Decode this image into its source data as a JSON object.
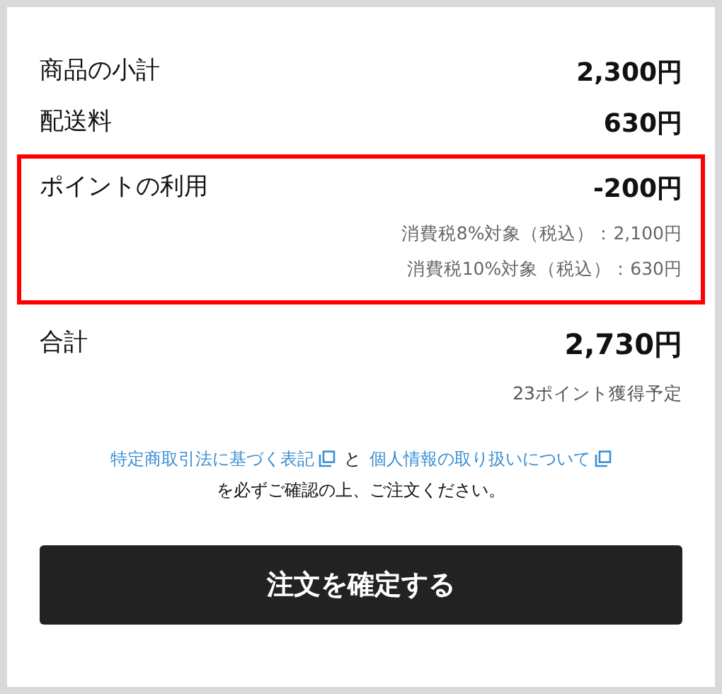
{
  "summary_rows": [
    {
      "label": "商品の小計",
      "value": "2,300円",
      "highlighted": false,
      "tax_lines": []
    },
    {
      "label": "配送料",
      "value": "630円",
      "highlighted": false,
      "tax_lines": []
    },
    {
      "label": "ポイントの利用",
      "value": "-200円",
      "highlighted": true,
      "tax_lines": [
        "消費税8%対象（税込）：2,100円",
        "消費税10%対象（税込）：630円"
      ]
    }
  ],
  "total": {
    "label": "合計",
    "value": "2,730円",
    "points_note": "23ポイント獲得予定"
  },
  "notice": {
    "links": [
      "特定商取引法に基づく表記",
      "個人情報の取り扱いについて"
    ],
    "connector": "と",
    "text": "を必ずご確認の上、ご注文ください。"
  },
  "confirm_button": "注文を確定する"
}
